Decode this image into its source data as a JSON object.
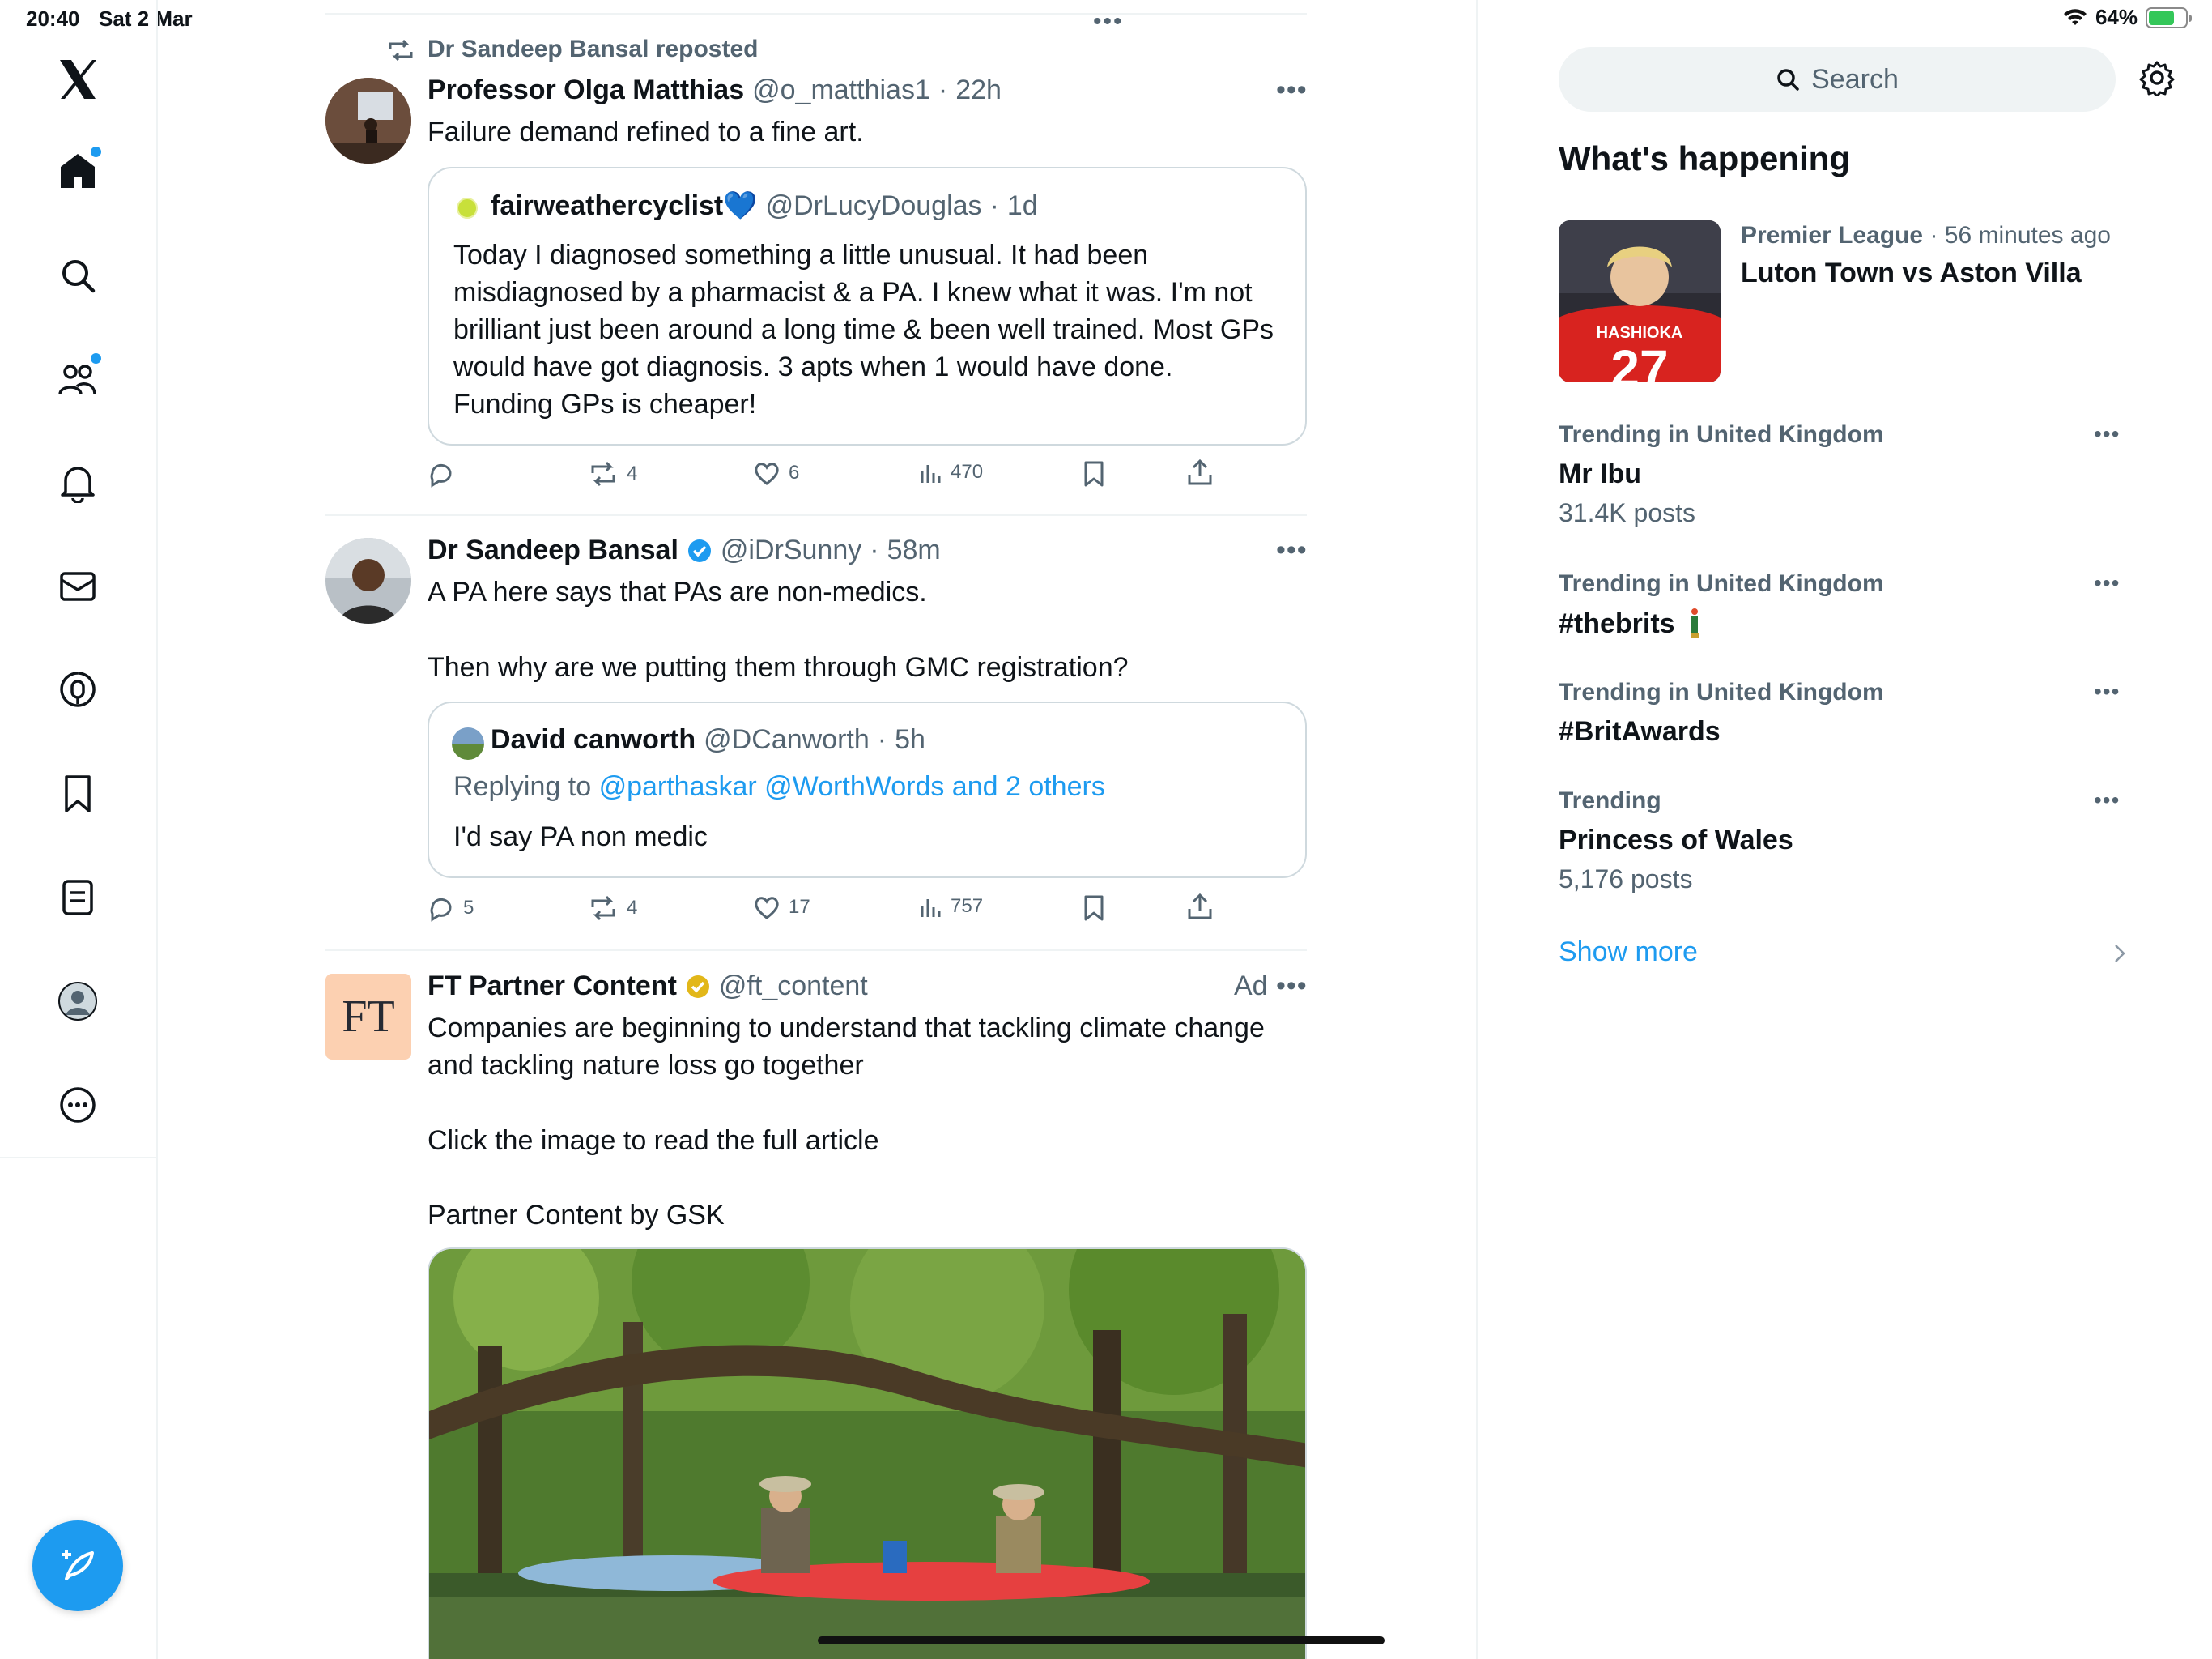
{
  "status_bar": {
    "time": "20:40",
    "date": "Sat 2 Mar",
    "battery": "64%",
    "battery_level": 0.64
  },
  "nav": {
    "items": [
      "home",
      "explore",
      "communities",
      "notifications",
      "messages",
      "spaces",
      "bookmarks",
      "lists",
      "profile",
      "more"
    ],
    "compose_label": "Compose"
  },
  "feed": {
    "tweet1": {
      "repost_label": "Dr Sandeep Bansal reposted",
      "name": "Professor Olga Matthias",
      "handle": "@o_matthias1",
      "time": "22h",
      "text": "Failure demand refined to a fine art.",
      "quote": {
        "name": "fairweathercyclist💙",
        "handle": "@DrLucyDouglas",
        "time": "1d",
        "text": "Today I diagnosed something a little unusual. It had been misdiagnosed by a pharmacist & a PA. I knew what it was. I'm not brilliant just been around a long time & been well trained. Most GPs would have got diagnosis. 3 apts when 1 would have done. Funding GPs is cheaper!"
      },
      "replies": "",
      "reposts": "4",
      "likes": "6",
      "views": "470"
    },
    "tweet2": {
      "name": "Dr Sandeep Bansal",
      "handle": "@iDrSunny",
      "time": "58m",
      "text_line1": "A PA here says that PAs are non-medics.",
      "text_line2": "Then why are we putting them through GMC registration?",
      "quote": {
        "name": "David canworth",
        "handle": "@DCanworth",
        "time": "5h",
        "replying_prefix": "Replying to",
        "replying_to": "@parthaskar @WorthWords and 2 others",
        "text": "I'd say PA non medic"
      },
      "replies": "5",
      "reposts": "4",
      "likes": "17",
      "views": "757"
    },
    "tweet3": {
      "avatar_text": "FT",
      "name": "FT Partner Content",
      "handle": "@ft_content",
      "ad_label": "Ad",
      "text_line1": "Companies are beginning to understand that tackling climate change and tackling nature loss go together",
      "text_line2": "Click the image to read the full article",
      "text_line3": "Partner Content by GSK"
    }
  },
  "sidebar": {
    "search_placeholder": "Search",
    "section_title": "What's happening",
    "featured": {
      "meta_category": "Premier League",
      "meta_time": "56 minutes ago",
      "title": "Luton Town vs Aston Villa",
      "image_text": "HASHIOKA",
      "image_number": "27"
    },
    "trends": [
      {
        "meta": "Trending in United Kingdom",
        "title": "Mr Ibu",
        "count": "31.4K posts"
      },
      {
        "meta": "Trending in United Kingdom",
        "title": "#thebrits",
        "count": ""
      },
      {
        "meta": "Trending in United Kingdom",
        "title": "#BritAwards",
        "count": ""
      },
      {
        "meta": "Trending",
        "title": "Princess of Wales",
        "count": "5,176 posts"
      }
    ],
    "show_more": "Show more"
  },
  "colors": {
    "accent": "#1d9bf0",
    "text": "#0f1419",
    "muted": "#536471",
    "border": "#eff3f4",
    "ft_bg": "#fcd0b1"
  }
}
